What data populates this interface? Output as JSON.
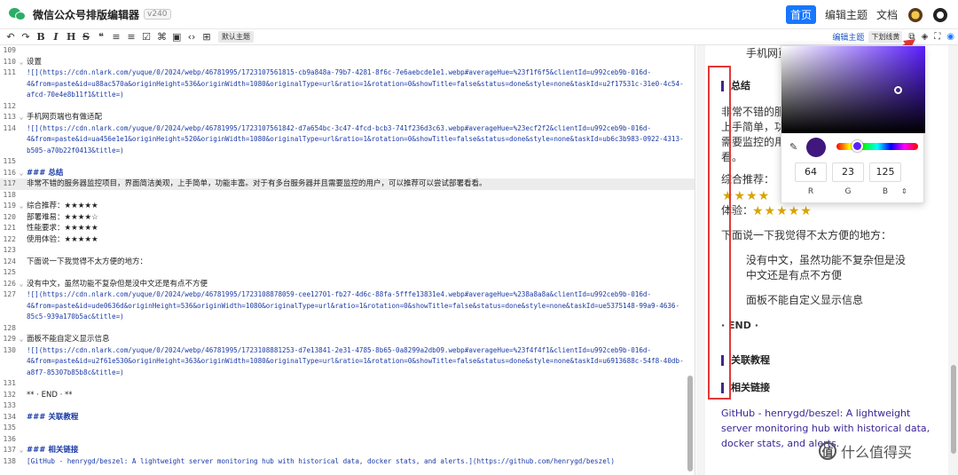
{
  "header": {
    "title": "微信公众号排版编辑器",
    "version": "v240",
    "nav": [
      "首页",
      "编辑主题",
      "文档"
    ]
  },
  "toolbar": {
    "buttons": [
      "↶",
      "↷",
      "B",
      "I",
      "H",
      "S",
      "❝",
      "≡",
      "≡",
      "☑",
      "⌘",
      "▣",
      "‹›",
      "⊞"
    ],
    "theme_tag": "默认主题",
    "edit_theme": "编辑主题",
    "underline_chip": "下划线黄"
  },
  "editor": {
    "lines": [
      {
        "n": "109",
        "f": "",
        "t": "",
        "k": "text"
      },
      {
        "n": "110",
        "f": "⌄",
        "t": "设置",
        "k": "text"
      },
      {
        "n": "111",
        "f": "",
        "t": "![](https://cdn.nlark.com/yuque/0/2024/webp/46781995/1723107561815-cb9a848a-79b7-4281-8f6c-7e6aebcde1e1.webp#averageHue=%23f1f6f5&clientId=u992ceb9b-016d-",
        "k": "url"
      },
      {
        "n": "",
        "f": "",
        "t": "4&from=paste&id=u88ac570a&originHeight=536&originWidth=1080&originalType=url&ratio=1&rotation=0&showTitle=false&status=done&style=none&taskId=u2f17531c-31e0-4c54-",
        "k": "url"
      },
      {
        "n": "",
        "f": "",
        "t": "afcd-70e4e8b11f1&title=)",
        "k": "url"
      },
      {
        "n": "112",
        "f": "",
        "t": "",
        "k": "text"
      },
      {
        "n": "113",
        "f": "⌄",
        "t": "手机网页端也有做适配",
        "k": "text"
      },
      {
        "n": "114",
        "f": "",
        "t": "![](https://cdn.nlark.com/yuque/0/2024/webp/46781995/1723107561842-d7a654bc-3c47-4fcd-bcb3-741f236d3c63.webp#averageHue=%23ecf2f2&clientId=u992ceb9b-016d-",
        "k": "url"
      },
      {
        "n": "",
        "f": "",
        "t": "4&from=paste&id=ua456e1e1&originHeight=520&originWidth=1080&originalType=url&ratio=1&rotation=0&showTitle=false&status=done&style=none&taskId=ub6c3b983-0922-4313-",
        "k": "url"
      },
      {
        "n": "",
        "f": "",
        "t": "b505-a70b22f0413&title=)",
        "k": "url"
      },
      {
        "n": "115",
        "f": "",
        "t": "",
        "k": "text"
      },
      {
        "n": "116",
        "f": "⌄",
        "t": "### 总结",
        "k": "heading"
      },
      {
        "n": "117",
        "f": "",
        "t": "非常不错的服务器监控项目，界面简洁美观，上手简单，功能丰富。对于有多台服务器并且需要监控的用户，可以推荐可以尝试部署看看。",
        "k": "text",
        "hl": true
      },
      {
        "n": "118",
        "f": "",
        "t": "",
        "k": "text"
      },
      {
        "n": "119",
        "f": "⌄",
        "t": "综合推荐：★★★★★",
        "k": "text"
      },
      {
        "n": "120",
        "f": "",
        "t": "部署难易：★★★★☆",
        "k": "text"
      },
      {
        "n": "121",
        "f": "",
        "t": "性能要求：★★★★★",
        "k": "text"
      },
      {
        "n": "122",
        "f": "",
        "t": "使用体验：★★★★★",
        "k": "text"
      },
      {
        "n": "123",
        "f": "",
        "t": "",
        "k": "text"
      },
      {
        "n": "124",
        "f": "",
        "t": "下面说一下我觉得不太方便的地方：",
        "k": "text"
      },
      {
        "n": "125",
        "f": "",
        "t": "",
        "k": "text"
      },
      {
        "n": "126",
        "f": "⌄",
        "t": "没有中文，虽然功能不复杂但是没中文还是有点不方便",
        "k": "text"
      },
      {
        "n": "127",
        "f": "",
        "t": "![](https://cdn.nlark.com/yuque/0/2024/webp/46781995/1723108878059-cee12701-fb27-4d6c-88fa-5fffe13831e4.webp#averageHue=%238a8a8a&clientId=u992ceb9b-016d-",
        "k": "url"
      },
      {
        "n": "",
        "f": "",
        "t": "4&from=paste&id=ude0636d&originHeight=536&originWidth=1080&originalType=url&ratio=1&rotation=0&showTitle=false&status=done&style=none&taskId=ue5375148-99a9-4636-",
        "k": "url"
      },
      {
        "n": "",
        "f": "",
        "t": "85c5-939a170b5ac&title=)",
        "k": "url"
      },
      {
        "n": "128",
        "f": "",
        "t": "",
        "k": "text"
      },
      {
        "n": "129",
        "f": "⌄",
        "t": "面板不能自定义显示信息",
        "k": "text"
      },
      {
        "n": "130",
        "f": "",
        "t": "![](https://cdn.nlark.com/yuque/0/2024/webp/46781995/1723108881253-d7e13841-2e31-4785-8b65-0a8299a2db09.webp#averageHue=%23f4f4f1&clientId=u992ceb9b-016d-",
        "k": "url"
      },
      {
        "n": "",
        "f": "",
        "t": "4&from=paste&id=u2f61e530&originHeight=363&originWidth=1080&originalType=url&ratio=1&rotation=0&showTitle=false&status=done&style=none&taskId=u6913688c-54f8-40db-",
        "k": "url"
      },
      {
        "n": "",
        "f": "",
        "t": "a8f7-85307b85b8c&title=)",
        "k": "url"
      },
      {
        "n": "131",
        "f": "",
        "t": "",
        "k": "text"
      },
      {
        "n": "132",
        "f": "",
        "t": "** · END · **",
        "k": "text"
      },
      {
        "n": "133",
        "f": "",
        "t": "",
        "k": "text"
      },
      {
        "n": "134",
        "f": "",
        "t": "### 关联教程",
        "k": "heading"
      },
      {
        "n": "135",
        "f": "",
        "t": "",
        "k": "text"
      },
      {
        "n": "136",
        "f": "",
        "t": "",
        "k": "text"
      },
      {
        "n": "137",
        "f": "⌄",
        "t": "### 相关链接",
        "k": "heading"
      },
      {
        "n": "138",
        "f": "",
        "t": "[GitHub - henrygd/beszel: A lightweight server monitoring hub with historical data, docker stats, and alerts.](https://github.com/henrygd/beszel)",
        "k": "url"
      }
    ]
  },
  "preview": {
    "top_text": "手机网页",
    "h_summary": "总结",
    "summary_lines": [
      "非常不错的服",
      "上手简单，功",
      "需要监控的用",
      "看。"
    ],
    "rating_label_1": "综合推荐：",
    "stars_2": "★★★★",
    "rating_label_4": "体验：",
    "stars_4": "★★★★★",
    "inconvenient": "下面说一下我觉得不太方便的地方：",
    "quote1_line1": "没有中文，虽然功能不复杂但是没",
    "quote1_line2": "中文还是有点不方便",
    "quote2": "面板不能自定义显示信息",
    "end": "· END ·",
    "h_related_tutorial": "关联教程",
    "h_related_links": "相关链接",
    "link_text": "GitHub - henrygd/beszel: A lightweight server monitoring hub with historical data, docker stats, and alerts."
  },
  "color_picker": {
    "r": "64",
    "g": "23",
    "b": "125",
    "label_r": "R",
    "label_g": "G",
    "label_b": "B",
    "selected_color": "#40177d"
  },
  "watermark": {
    "text": "什么值得买",
    "mark": "值"
  }
}
